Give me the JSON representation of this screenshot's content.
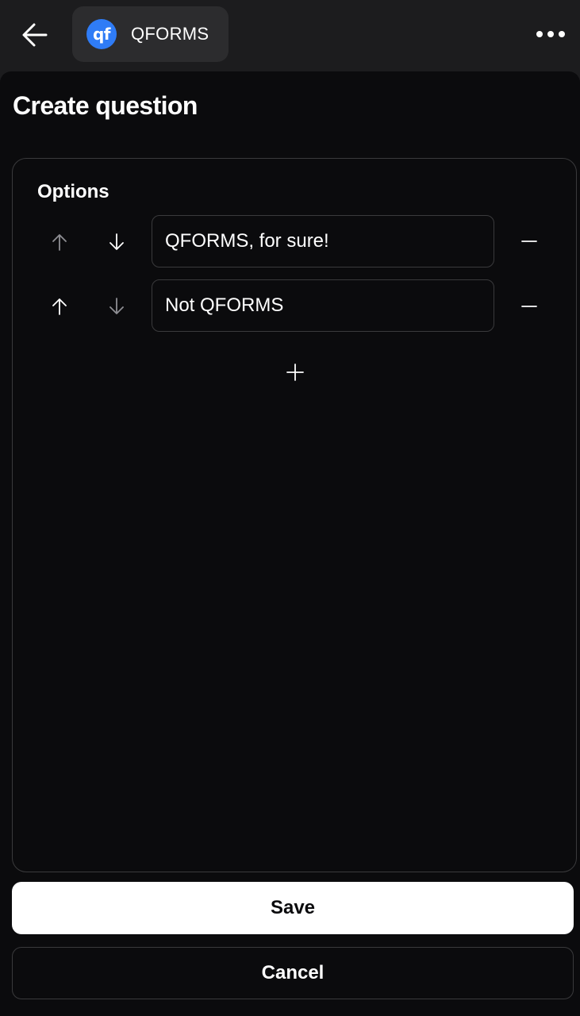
{
  "header": {
    "app_logo_text": "qf",
    "app_name": "QFORMS",
    "back_icon": "arrow-left-icon",
    "more_icon": "ellipsis-icon"
  },
  "page": {
    "title": "Create question"
  },
  "options": {
    "label": "Options",
    "items": [
      {
        "value": "QFORMS, for sure!",
        "move_up_enabled": false,
        "move_down_enabled": true
      },
      {
        "value": "Not QFORMS",
        "move_up_enabled": true,
        "move_down_enabled": false
      }
    ],
    "add_icon": "plus-icon",
    "remove_icon": "minus-icon"
  },
  "actions": {
    "save_label": "Save",
    "cancel_label": "Cancel"
  },
  "colors": {
    "background": "#0b0b0d",
    "topbar": "#1c1c1e",
    "chip": "#2c2c2e",
    "brand": "#2f7cf6",
    "border": "#3a3a3c",
    "icon_enabled": "#ffffff",
    "icon_disabled": "#8e8e93"
  }
}
